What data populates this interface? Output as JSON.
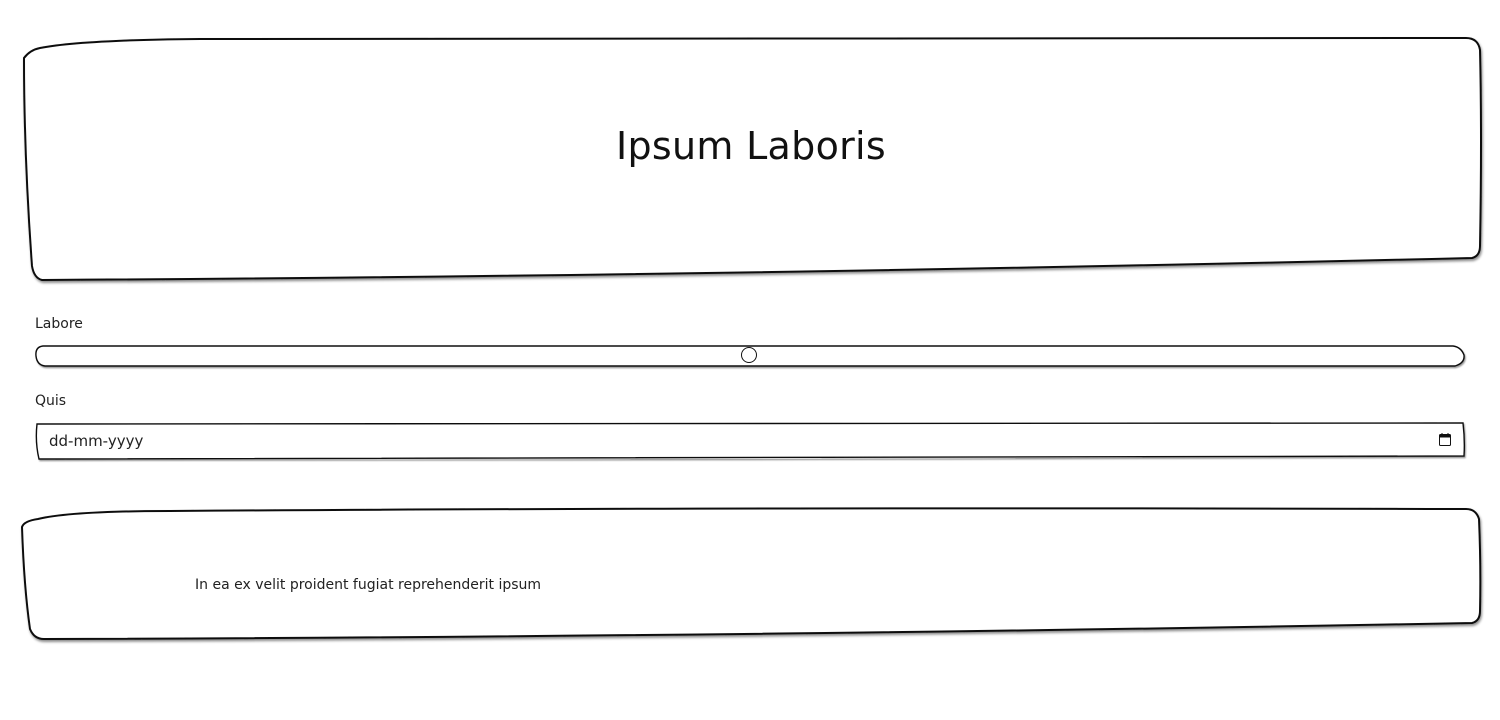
{
  "header": {
    "title": "Ipsum Laboris"
  },
  "form": {
    "slider": {
      "label": "Labore",
      "value_percent": 50
    },
    "date": {
      "label": "Quis",
      "placeholder": "dd-mm-yyyy"
    }
  },
  "content": {
    "text": "In ea ex velit proident fugiat reprehenderit ipsum"
  },
  "icons": {
    "calendar": "calendar-icon"
  }
}
